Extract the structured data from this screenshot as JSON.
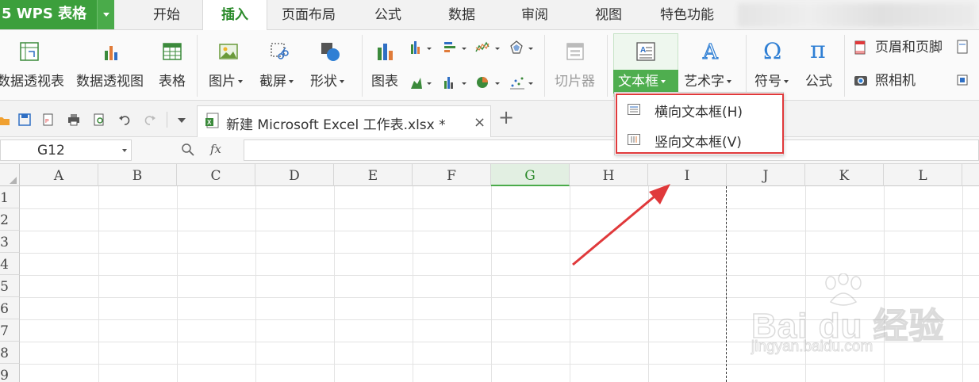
{
  "app": {
    "logo": "5 WPS 表格"
  },
  "menu": {
    "tabs": [
      {
        "label": "开始"
      },
      {
        "label": "插入"
      },
      {
        "label": "页面布局"
      },
      {
        "label": "公式"
      },
      {
        "label": "数据"
      },
      {
        "label": "审阅"
      },
      {
        "label": "视图"
      },
      {
        "label": "特色功能"
      }
    ],
    "active_tab": "插入"
  },
  "ribbon": {
    "pivot_table": "数据透视表",
    "pivot_chart": "数据透视图",
    "table": "表格",
    "picture": "图片",
    "screenshot": "截屏",
    "shape": "形状",
    "chart": "图表",
    "slicer": "切片器",
    "textbox": "文本框",
    "wordart": "艺术字",
    "symbol": "符号",
    "formula": "公式",
    "header_footer": "页眉和页脚",
    "camera": "照相机"
  },
  "textbox_menu": {
    "items": [
      {
        "label": "横向文本框(H)",
        "icon": "horizontal-textbox-icon"
      },
      {
        "label": "竖向文本框(V)",
        "icon": "vertical-textbox-icon"
      }
    ]
  },
  "document": {
    "tab_title": "新建 Microsoft Excel 工作表.xlsx *",
    "close": "×",
    "new_tab": "+"
  },
  "formula_bar": {
    "cell_ref": "G12",
    "fx": "fx",
    "value": ""
  },
  "sheet": {
    "columns": [
      "A",
      "B",
      "C",
      "D",
      "E",
      "F",
      "G",
      "H",
      "I",
      "J",
      "K",
      "L"
    ],
    "rows": [
      "1",
      "2",
      "3",
      "4",
      "5",
      "6",
      "7",
      "8",
      "9"
    ],
    "selected_column": "G"
  },
  "watermark": {
    "text": "Bai du 经验",
    "url": "jingyan.baidu.com"
  },
  "colors": {
    "accent": "#4aab4a",
    "highlight": "#e0393b"
  }
}
